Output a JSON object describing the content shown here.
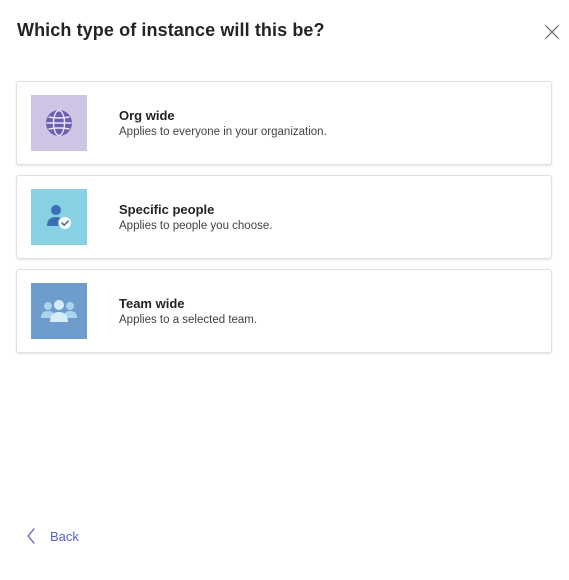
{
  "dialog": {
    "title": "Which type of instance will this be?",
    "close_icon": "close-icon"
  },
  "options": [
    {
      "title": "Org wide",
      "description": "Applies to everyone in your organization.",
      "icon": "globe-icon",
      "tile_color": "#cdc5e3"
    },
    {
      "title": "Specific people",
      "description": "Applies to people you choose.",
      "icon": "person-check-icon",
      "tile_color": "#86d1e4"
    },
    {
      "title": "Team wide",
      "description": "Applies to a selected team.",
      "icon": "people-team-icon",
      "tile_color": "#6e9ccc"
    }
  ],
  "footer": {
    "back_label": "Back",
    "back_icon": "chevron-left-icon"
  },
  "colors": {
    "accent": "#5b5fc7",
    "text": "#242424"
  }
}
